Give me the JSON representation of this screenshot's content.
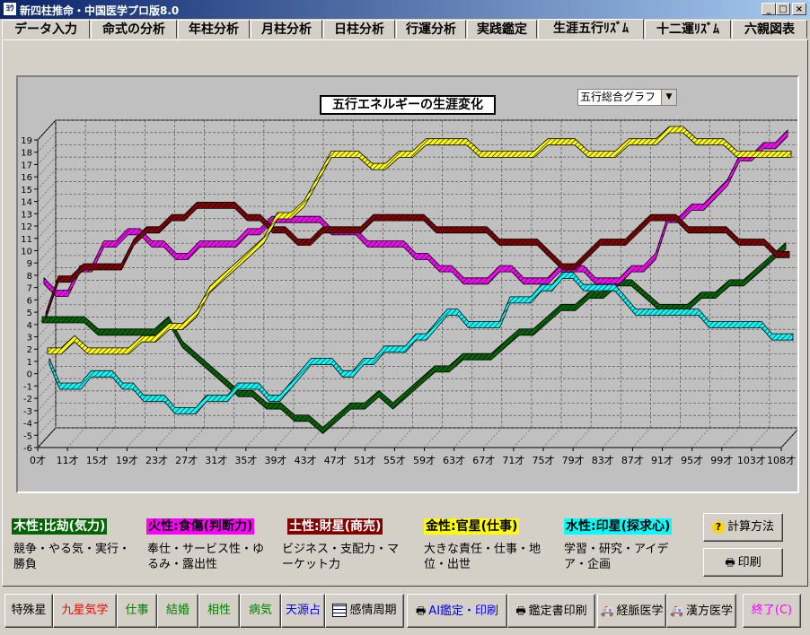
{
  "window": {
    "title": "新四柱推命・中国医学プロ版8.0",
    "app_icon": "ﾖｳ",
    "controls": [
      "_",
      "□",
      "×"
    ]
  },
  "tabs": [
    {
      "label": "データ入力"
    },
    {
      "label": "命式の分析"
    },
    {
      "label": "年柱分析"
    },
    {
      "label": "月柱分析"
    },
    {
      "label": "日柱分析"
    },
    {
      "label": "行運分析"
    },
    {
      "label": "実践鑑定"
    },
    {
      "label": "生涯五行ﾘｽﾞﾑ",
      "active": true
    },
    {
      "label": "十二運ﾘｽﾞﾑ"
    },
    {
      "label": "六親図表"
    }
  ],
  "chart": {
    "dropdown_value": "五行総合グラフ"
  },
  "chart_data": {
    "type": "line",
    "title": "五行エネルギーの生涯変化",
    "x_labels": [
      "0才",
      "11才",
      "15才",
      "19才",
      "23才",
      "27才",
      "31才",
      "35才",
      "39才",
      "43才",
      "47才",
      "51才",
      "55才",
      "59才",
      "63才",
      "67才",
      "71才",
      "75才",
      "79才",
      "83才",
      "87才",
      "91才",
      "95才",
      "99才",
      "103才",
      "108才"
    ],
    "ylim": [
      -6,
      19
    ],
    "y_ticks": [
      -6,
      -5,
      -4,
      -3,
      -2,
      -1,
      0,
      1,
      2,
      3,
      4,
      5,
      6,
      7,
      8,
      9,
      10,
      11,
      12,
      13,
      14,
      15,
      16,
      17,
      18,
      19
    ],
    "grid": true,
    "series": [
      {
        "name": "木性:比劫(気力)",
        "color": "#006400",
        "values": [
          4,
          4,
          4,
          4,
          3,
          3,
          3,
          3,
          3,
          4,
          2,
          1,
          0,
          -1,
          -2,
          -2,
          -3,
          -3,
          -4,
          -4,
          -5,
          -4,
          -3,
          -3,
          -2,
          -3,
          -2,
          -1,
          0,
          0,
          1,
          1,
          1,
          2,
          3,
          3,
          4,
          5,
          5,
          6,
          6,
          7,
          7,
          6,
          5,
          5,
          5,
          6,
          6,
          7,
          7,
          8,
          9,
          10
        ]
      },
      {
        "name": "火性:食傷(判断力)",
        "color": "#ff00ff",
        "values": [
          7,
          6,
          6,
          8,
          8,
          10,
          10,
          11,
          11,
          10,
          10,
          9,
          9,
          10,
          10,
          10,
          10,
          11,
          11,
          12,
          12,
          12,
          12,
          12,
          11,
          11,
          11,
          10,
          10,
          10,
          10,
          9,
          9,
          8,
          8,
          7,
          7,
          7,
          8,
          8,
          7,
          7,
          7,
          8,
          8,
          8,
          7,
          7,
          7,
          8,
          8,
          9,
          12,
          12,
          13,
          13,
          14,
          15,
          17,
          17,
          18,
          18,
          19
        ]
      },
      {
        "name": "土性:財星(商売)",
        "color": "#800000",
        "values": [
          4,
          7,
          7,
          8,
          8,
          8,
          8,
          10,
          11,
          11,
          12,
          12,
          13,
          13,
          13,
          13,
          12,
          12,
          11,
          11,
          10,
          10,
          11,
          11,
          11,
          11,
          12,
          12,
          12,
          12,
          12,
          11,
          11,
          11,
          11,
          11,
          10,
          10,
          10,
          10,
          9,
          8,
          8,
          9,
          10,
          10,
          10,
          11,
          12,
          12,
          12,
          11,
          11,
          11,
          11,
          10,
          10,
          10,
          9,
          9
        ]
      },
      {
        "name": "金性:官星(仕事)",
        "color": "#ffff00",
        "values": [
          1,
          1,
          2,
          1,
          1,
          1,
          1,
          2,
          2,
          3,
          3,
          4,
          6,
          7,
          8,
          9,
          10,
          12,
          12,
          13,
          15,
          17,
          17,
          17,
          16,
          16,
          17,
          17,
          18,
          18,
          18,
          18,
          17,
          17,
          17,
          17,
          17,
          18,
          18,
          18,
          17,
          17,
          17,
          18,
          18,
          18,
          19,
          19,
          18,
          18,
          18,
          17,
          17,
          17,
          17,
          17
        ]
      },
      {
        "name": "水性:印星(探求心)",
        "color": "#00ffff",
        "values": [
          0,
          -2,
          -2,
          -2,
          -1,
          -1,
          -1,
          -2,
          -2,
          -3,
          -3,
          -3,
          -4,
          -4,
          -4,
          -3,
          -3,
          -3,
          -2,
          -2,
          -2,
          -3,
          -3,
          -2,
          -1,
          0,
          0,
          0,
          -1,
          -1,
          0,
          0,
          1,
          1,
          1,
          2,
          2,
          3,
          4,
          4,
          3,
          3,
          3,
          3,
          5,
          5,
          5,
          6,
          6,
          7,
          7,
          6,
          6,
          6,
          6,
          5,
          4,
          4,
          4,
          4,
          4,
          4,
          4,
          3,
          3,
          3,
          3,
          3,
          3,
          2,
          2,
          2
        ]
      }
    ]
  },
  "legend": [
    {
      "label": "木性:比劫(気力)",
      "bg": "#006400",
      "fg": "#ffffff",
      "desc": "競争・やる気・実行・勝負"
    },
    {
      "label": "火性:食傷(判断力)",
      "bg": "#ff00ff",
      "fg": "#000000",
      "desc": "奉仕・サービス性・ゆるみ・露出性"
    },
    {
      "label": "土性:財星(商売)",
      "bg": "#800000",
      "fg": "#ffffff",
      "desc": "ビジネス・支配力・マーケット力"
    },
    {
      "label": "金性:官星(仕事)",
      "bg": "#ffff00",
      "fg": "#000000",
      "desc": "大きな責任・仕事・地位・出世"
    },
    {
      "label": "水性:印星(探求心)",
      "bg": "#00ffff",
      "fg": "#000000",
      "desc": "学習・研究・アイデア・企画"
    }
  ],
  "side_buttons": {
    "calc_label": "計算方法",
    "calc_icon": "question-icon",
    "print_label": "印刷",
    "print_icon": "printer-icon"
  },
  "bottom_buttons": [
    {
      "label": "特殊星",
      "color": "#000000"
    },
    {
      "label": "九星気学",
      "color": "#ff0000"
    },
    {
      "label": "仕事",
      "color": "#008000"
    },
    {
      "label": "結婚",
      "color": "#008000"
    },
    {
      "label": "相性",
      "color": "#008000"
    },
    {
      "label": "病気",
      "color": "#008000"
    },
    {
      "label": "天源占",
      "color": "#0000ff"
    },
    {
      "label": "感情周期",
      "color": "#000000",
      "icon": "calendar-icon"
    },
    {
      "label": "AI鑑定・印刷",
      "color": "#0000ff",
      "icon": "printer-icon"
    },
    {
      "label": "鑑定書印刷",
      "color": "#000000",
      "icon": "printer-icon"
    },
    {
      "label": "経脈医学",
      "color": "#000000",
      "icon": "ambulance-icon"
    },
    {
      "label": "漢方医学",
      "color": "#000000",
      "icon": "ambulance-icon"
    },
    {
      "label": "終了(C)",
      "color": "#ff00ff"
    }
  ]
}
